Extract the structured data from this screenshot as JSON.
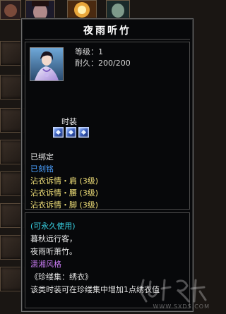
{
  "tooltip": {
    "title": "夜雨听竹",
    "stats": {
      "level": "等级：1",
      "durability": "耐久：200/200"
    },
    "socket_label": "时装",
    "socket_count": 3,
    "lines": {
      "bound": "已绑定",
      "engraved": "已刻铭",
      "attr_shoulder": "沾衣诉情・肩 (3级)",
      "attr_waist": "沾衣诉情・腰 (3级)",
      "attr_foot": "沾衣诉情・脚 (3级)"
    },
    "lore": {
      "permanent": "(可永久使用)",
      "verse1": "暮秋远行客，",
      "verse2": "夜雨听萧竹。",
      "style": "潇湘风格",
      "collection": "《珍缕集：绣衣》",
      "desc": "该类时装可在珍缕集中增加1点绣衣值"
    }
  },
  "watermark": {
    "site": "WWW.SXDS.COM"
  },
  "colors": {
    "bound": "#e6e6e6",
    "engraved": "#4aa0ff",
    "attribute": "#f3e27a",
    "permanent": "#39d4e6",
    "style": "#c97cf4"
  },
  "icons": [
    "fashion-item-icon",
    "blue-gem-socket-icon"
  ]
}
